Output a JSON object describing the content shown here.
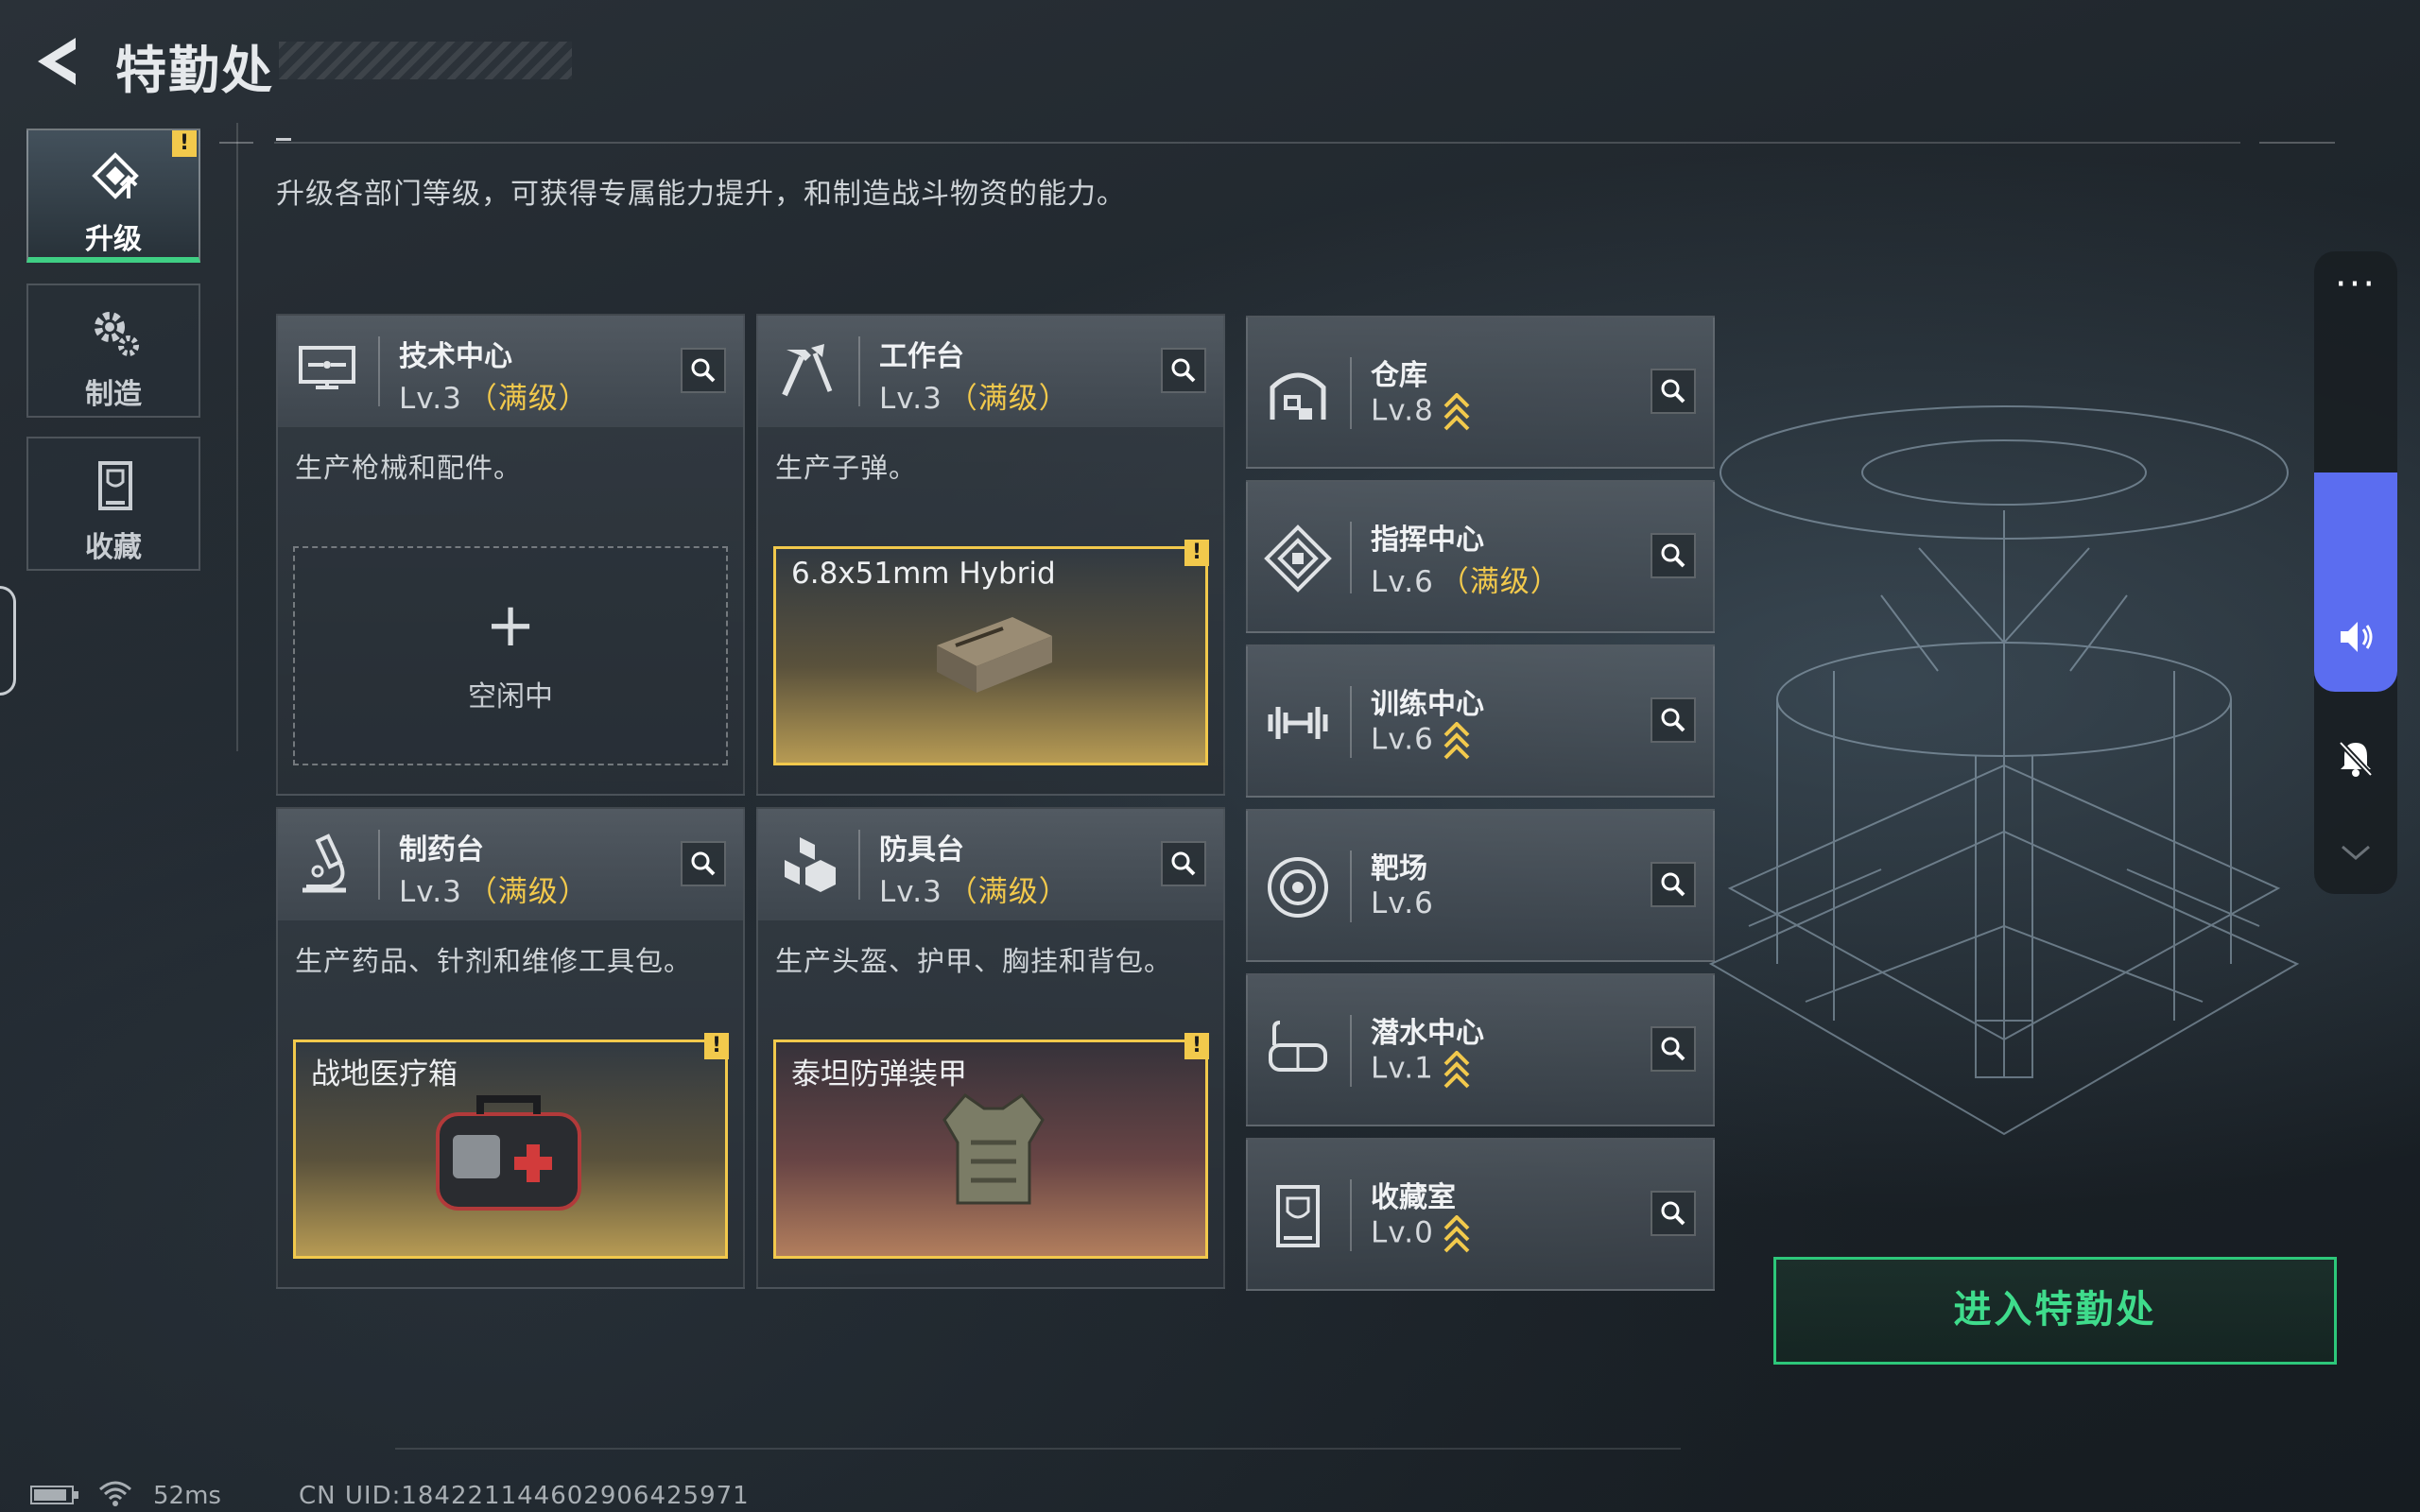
{
  "header": {
    "title": "特勤处"
  },
  "subtitle": "升级各部门等级，可获得专属能力提升，和制造战斗物资的能力。",
  "tabs": [
    {
      "label": "升级",
      "active": true,
      "has_alert": true
    },
    {
      "label": "制造",
      "active": false
    },
    {
      "label": "收藏",
      "active": false
    }
  ],
  "alert_glyph": "!",
  "departments": [
    {
      "name": "技术中心",
      "level": "Lv.3",
      "max": "（满级）",
      "desc": "生产枪械和配件。",
      "slot": {
        "state": "空闲中",
        "plus": "+"
      }
    },
    {
      "name": "工作台",
      "level": "Lv.3",
      "max": "（满级）",
      "desc": "生产子弹。",
      "slot": {
        "item": "6.8x51mm Hybrid"
      }
    },
    {
      "name": "制药台",
      "level": "Lv.3",
      "max": "（满级）",
      "desc": "生产药品、针剂和维修工具包。",
      "slot": {
        "item": "战地医疗箱"
      }
    },
    {
      "name": "防具台",
      "level": "Lv.3",
      "max": "（满级）",
      "desc": "生产头盔、护甲、胸挂和背包。",
      "slot": {
        "item": "泰坦防弹装甲"
      }
    }
  ],
  "facilities": [
    {
      "name": "仓库",
      "level": "Lv.8",
      "max": "",
      "upgradable": true
    },
    {
      "name": "指挥中心",
      "level": "Lv.6",
      "max": "（满级）",
      "upgradable": false
    },
    {
      "name": "训练中心",
      "level": "Lv.6",
      "max": "",
      "upgradable": true
    },
    {
      "name": "靶场",
      "level": "Lv.6",
      "max": "",
      "upgradable": false
    },
    {
      "name": "潜水中心",
      "level": "Lv.1",
      "max": "",
      "upgradable": true
    },
    {
      "name": "收藏室",
      "level": "Lv.0",
      "max": "",
      "upgradable": true
    }
  ],
  "side_panel": {
    "more": "···",
    "volume_level": 0.6
  },
  "enter_button": "进入特勤处",
  "status": {
    "ping": "52ms",
    "uid": "CN UID:184221144602906425971"
  },
  "colors": {
    "accent_green": "#3fdc8c",
    "max_gold": "#f2c94c",
    "volume_blue": "#5b6df0"
  }
}
